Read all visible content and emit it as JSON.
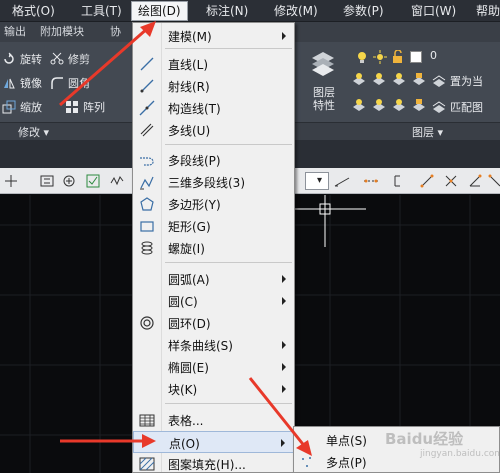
{
  "menubar": {
    "items": [
      "格式(O)",
      "工具(T)",
      "绘图(D)",
      "标注(N)",
      "修改(M)",
      "参数(P)",
      "窗口(W)",
      "帮助"
    ]
  },
  "ribbon": {
    "tabs": [
      "输出",
      "附加模块",
      "协"
    ],
    "modify_tools": [
      "旋转",
      "修剪",
      "镜像",
      "圆角",
      "缩放",
      "阵列"
    ],
    "layer_panel_label": "图层\n特性",
    "layer_name": "0",
    "layer_tools": [
      "置为当",
      "匹配图"
    ],
    "panel_titles": {
      "modify": "修改",
      "layer": "图层"
    }
  },
  "draw_menu": {
    "items": [
      {
        "label": "建模(M)",
        "icon": "none",
        "submenu": true
      },
      {
        "label": "直线(L)",
        "icon": "line-icon"
      },
      {
        "label": "射线(R)",
        "icon": "ray-icon"
      },
      {
        "label": "构造线(T)",
        "icon": "xline-icon"
      },
      {
        "label": "多线(U)",
        "icon": "mline-icon"
      },
      {
        "label": "多段线(P)",
        "icon": "polyline-icon"
      },
      {
        "label": "三维多段线(3)",
        "icon": "3dpoly-icon"
      },
      {
        "label": "多边形(Y)",
        "icon": "polygon-icon"
      },
      {
        "label": "矩形(G)",
        "icon": "rectangle-icon"
      },
      {
        "label": "螺旋(I)",
        "icon": "helix-icon"
      },
      {
        "label": "圆弧(A)",
        "icon": "none",
        "submenu": true
      },
      {
        "label": "圆(C)",
        "icon": "none",
        "submenu": true
      },
      {
        "label": "圆环(D)",
        "icon": "donut-icon"
      },
      {
        "label": "样条曲线(S)",
        "icon": "none",
        "submenu": true
      },
      {
        "label": "椭圆(E)",
        "icon": "none",
        "submenu": true
      },
      {
        "label": "块(K)",
        "icon": "none",
        "submenu": true
      },
      {
        "label": "表格...",
        "icon": "table-icon"
      },
      {
        "label": "点(O)",
        "icon": "none",
        "submenu": true
      },
      {
        "label": "图案填充(H)...",
        "icon": "hatch-icon"
      }
    ]
  },
  "point_submenu": {
    "items": [
      {
        "label": "单点(S)",
        "icon": "none"
      },
      {
        "label": "多点(P)",
        "icon": "multipoint-icon"
      }
    ]
  },
  "watermark": {
    "text": "Baidu经验",
    "url": "jingyan.baidu.com"
  },
  "colors": {
    "accent": "#e8392a",
    "canvas": "#0a0b0d",
    "menu_bg": "#f0f0f0"
  }
}
